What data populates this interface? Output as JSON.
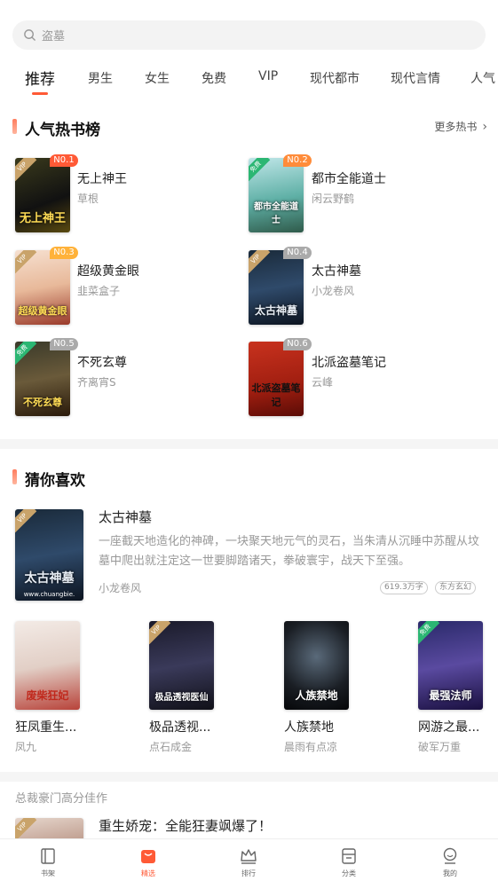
{
  "search": {
    "placeholder": "盗墓"
  },
  "tabs": [
    {
      "label": "推荐",
      "active": true
    },
    {
      "label": "男生"
    },
    {
      "label": "女生"
    },
    {
      "label": "免费"
    },
    {
      "label": "VIP"
    },
    {
      "label": "现代都市"
    },
    {
      "label": "现代言情"
    },
    {
      "label": "人气"
    }
  ],
  "hot": {
    "title": "人气热书榜",
    "more": "更多热书",
    "books": [
      {
        "rank": "N0.1",
        "name": "无上神王",
        "author": "草根",
        "corner": "VIP",
        "cover_text": "无上神王",
        "rank_color": "#ff5a36"
      },
      {
        "rank": "N0.2",
        "name": "都市全能道士",
        "author": "闲云野鹤",
        "corner": "免费",
        "cover_text": "都市全能道士",
        "rank_color": "#ff8c3a"
      },
      {
        "rank": "N0.3",
        "name": "超级黄金眼",
        "author": "韭菜盒子",
        "corner": "VIP",
        "cover_text": "超级黄金眼",
        "rank_color": "#ffb23a"
      },
      {
        "rank": "N0.4",
        "name": "太古神墓",
        "author": "小龙卷风",
        "corner": "VIP",
        "cover_text": "太古神墓",
        "rank_color": "#aaaaaa"
      },
      {
        "rank": "N0.5",
        "name": "不死玄尊",
        "author": "齐离宵S",
        "corner": "免费",
        "cover_text": "不死玄尊",
        "rank_color": "#aaaaaa"
      },
      {
        "rank": "N0.6",
        "name": "北派盗墓笔记",
        "author": "云峰",
        "corner": "",
        "cover_text": "北派盗墓笔记",
        "rank_color": "#aaaaaa"
      }
    ]
  },
  "guess": {
    "title": "猜你喜欢",
    "featured": {
      "name": "太古神墓",
      "desc": "一座截天地造化的神碑，一块聚天地元气的灵石，当朱清从沉睡中苏醒从坟墓中爬出就注定这一世要脚踏诸天，拳破寰宇，战天下至强。",
      "author": "小龙卷风",
      "tags": [
        "619.3万字",
        "东方玄幻"
      ],
      "corner": "VIP",
      "cover_text": "太古神墓",
      "cover_site": "www.chuangbie."
    },
    "grid": [
      {
        "name": "狂凤重生...",
        "author": "凤九",
        "corner": "",
        "cover_text": "废柴狂妃"
      },
      {
        "name": "极品透视...",
        "author": "点石成金",
        "corner": "VIP",
        "cover_text": "极品透视医仙"
      },
      {
        "name": "人族禁地",
        "author": "晨雨有点凉",
        "corner": "",
        "cover_text": "人族禁地"
      },
      {
        "name": "网游之最...",
        "author": "破军万重",
        "corner": "免费",
        "cover_text": "最强法师"
      }
    ]
  },
  "section3": {
    "title": "总裁豪门高分佳作",
    "first_book": "重生娇宠：全能狂妻飒爆了！",
    "corner": "VIP"
  },
  "tabbar": [
    {
      "label": "书架",
      "icon": "bookshelf-icon"
    },
    {
      "label": "精选",
      "icon": "featured-icon",
      "active": true
    },
    {
      "label": "排行",
      "icon": "ranking-crown-icon"
    },
    {
      "label": "分类",
      "icon": "category-icon"
    },
    {
      "label": "我的",
      "icon": "profile-icon"
    }
  ],
  "colors": {
    "accent": "#ff5a36"
  }
}
